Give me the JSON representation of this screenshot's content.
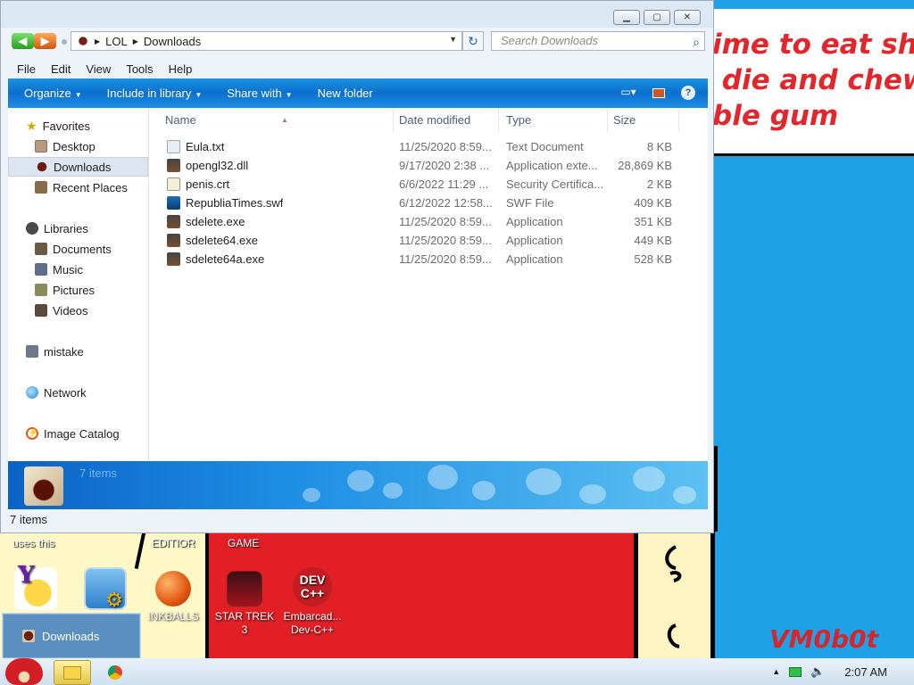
{
  "wallpaper": {
    "top_text": "ime to eat shit\n die and chew\nble gum",
    "signature": "VM0b0t",
    "label_left": "uses this",
    "label_editor": "EDITIOR",
    "label_game": "GAME"
  },
  "desktop_icons": [
    {
      "label": "",
      "icon": "yahoo-messenger-icon"
    },
    {
      "label": "",
      "icon": "control-panel-icon"
    },
    {
      "label": "INKBALLS",
      "icon": "inkballs-icon"
    },
    {
      "label": "STAR TREK 3",
      "icon": "star-trek-icon"
    },
    {
      "label": "Embarcad... Dev-C++",
      "icon": "dev-cpp-icon"
    }
  ],
  "window": {
    "buttons": {
      "minimize": "▁",
      "maximize": "▢",
      "close": "✕"
    },
    "address": {
      "root": "LOL",
      "current": "Downloads"
    },
    "search_placeholder": "Search Downloads",
    "menu": [
      "File",
      "Edit",
      "View",
      "Tools",
      "Help"
    ],
    "commands": [
      {
        "label": "Organize",
        "dropdown": true
      },
      {
        "label": "Include in library",
        "dropdown": true
      },
      {
        "label": "Share with",
        "dropdown": true
      },
      {
        "label": "New folder",
        "dropdown": false
      }
    ],
    "help_label": "?",
    "nav": {
      "favorites": {
        "label": "Favorites",
        "items": [
          "Desktop",
          "Downloads",
          "Recent Places"
        ],
        "selected": "Downloads"
      },
      "libraries": {
        "label": "Libraries",
        "items": [
          "Documents",
          "Music",
          "Pictures",
          "Videos"
        ]
      },
      "others": [
        "mistake",
        "Network",
        "Image Catalog"
      ]
    },
    "columns": [
      "Name",
      "Date modified",
      "Type",
      "Size"
    ],
    "files": [
      {
        "name": "Eula.txt",
        "date": "11/25/2020 8:59...",
        "type": "Text Document",
        "size": "8 KB",
        "icon": "text-file-icon"
      },
      {
        "name": "opengl32.dll",
        "date": "9/17/2020 2:38 ...",
        "type": "Application exte...",
        "size": "28,869 KB",
        "icon": "dll-file-icon"
      },
      {
        "name": "penis.crt",
        "date": "6/6/2022 11:29 ...",
        "type": "Security Certifica...",
        "size": "2 KB",
        "icon": "certificate-icon"
      },
      {
        "name": "RepubliaTimes.swf",
        "date": "6/12/2022 12:58...",
        "type": "SWF File",
        "size": "409 KB",
        "icon": "swf-file-icon"
      },
      {
        "name": "sdelete.exe",
        "date": "11/25/2020 8:59...",
        "type": "Application",
        "size": "351 KB",
        "icon": "exe-file-icon"
      },
      {
        "name": "sdelete64.exe",
        "date": "11/25/2020 8:59...",
        "type": "Application",
        "size": "449 KB",
        "icon": "exe-file-icon"
      },
      {
        "name": "sdelete64a.exe",
        "date": "11/25/2020 8:59...",
        "type": "Application",
        "size": "528 KB",
        "icon": "exe-file-icon"
      }
    ],
    "details_count": "7 items",
    "status": "7 items"
  },
  "taskbar": {
    "preview_label": "Downloads",
    "clock": "2:07 AM"
  }
}
